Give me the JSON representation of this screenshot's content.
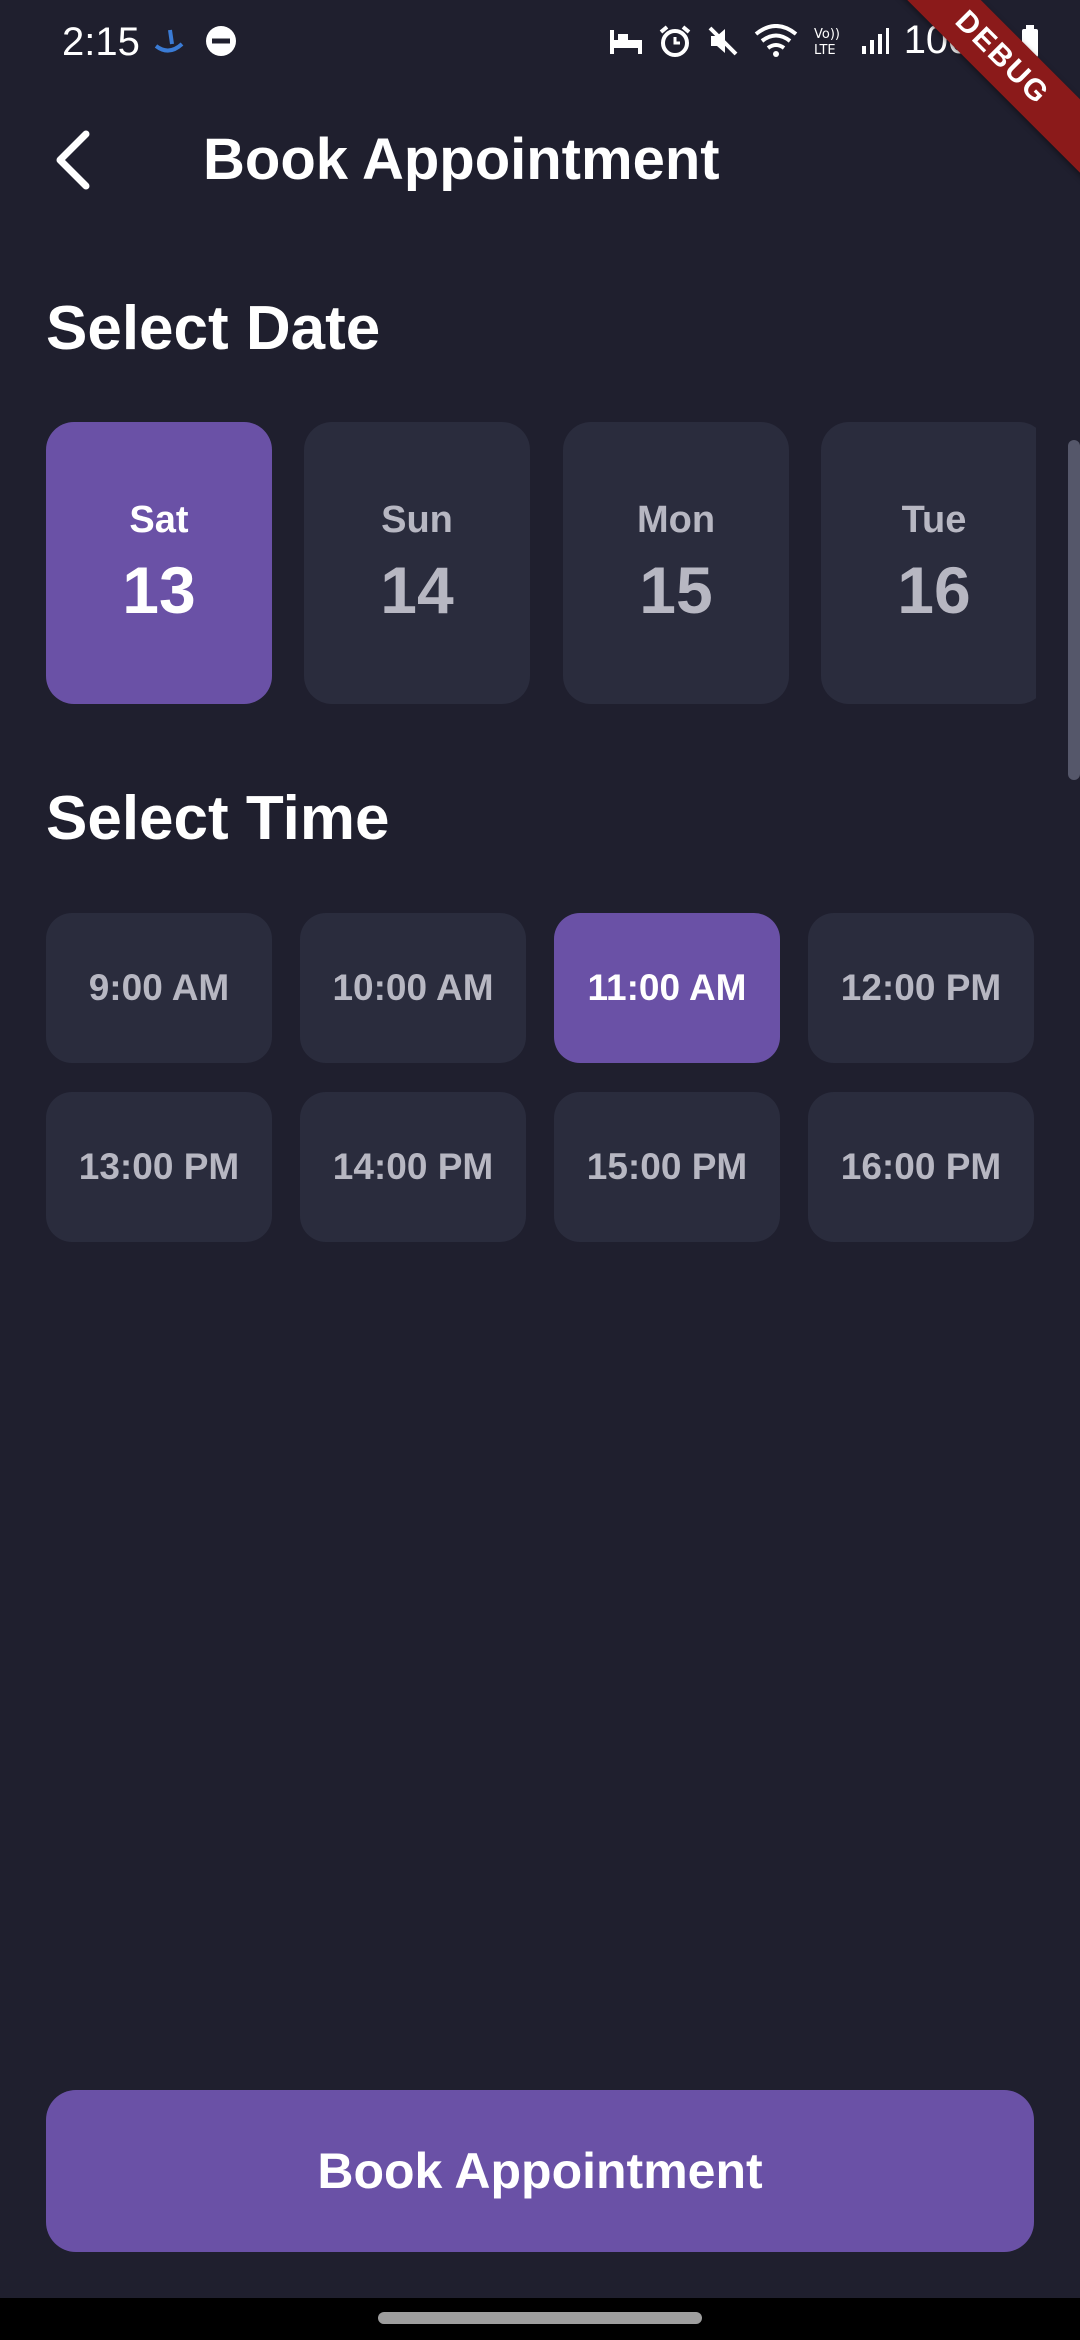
{
  "status_bar": {
    "time": "2:15",
    "battery": "100%",
    "icons": [
      "app-notification-icon",
      "do-not-disturb-icon",
      "sleep-icon",
      "alarm-icon",
      "mute-icon",
      "wifi-icon",
      "volte-icon",
      "signal-icon",
      "battery-icon"
    ]
  },
  "debug_banner": "DEBUG",
  "app_bar": {
    "back_icon": "back-arrow-icon",
    "title": "Book Appointment"
  },
  "date_section": {
    "title": "Select Date",
    "dates": [
      {
        "day": "Sat",
        "date": "13",
        "selected": true
      },
      {
        "day": "Sun",
        "date": "14",
        "selected": false
      },
      {
        "day": "Mon",
        "date": "15",
        "selected": false
      },
      {
        "day": "Tue",
        "date": "16",
        "selected": false
      }
    ]
  },
  "time_section": {
    "title": "Select Time",
    "slots": [
      {
        "label": "9:00 AM",
        "selected": false
      },
      {
        "label": "10:00 AM",
        "selected": false
      },
      {
        "label": "11:00 AM",
        "selected": true
      },
      {
        "label": "12:00 PM",
        "selected": false
      },
      {
        "label": "13:00 PM",
        "selected": false
      },
      {
        "label": "14:00 PM",
        "selected": false
      },
      {
        "label": "15:00 PM",
        "selected": false
      },
      {
        "label": "16:00 PM",
        "selected": false
      }
    ]
  },
  "book_button": {
    "label": "Book Appointment"
  },
  "colors": {
    "background": "#1f1f2e",
    "card": "#2a2c3d",
    "accent": "#6a51a6",
    "muted_text": "#b7b7c2"
  }
}
